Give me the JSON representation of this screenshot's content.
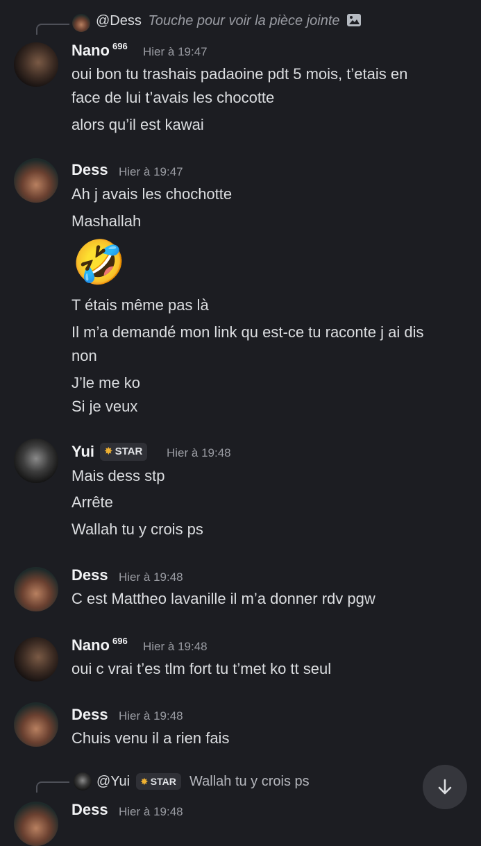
{
  "reply_top": {
    "author": "@Dess",
    "text": "Touche pour voir la pièce jointe",
    "attachment_icon": "image-icon"
  },
  "messages": [
    {
      "author": "Nano",
      "superscript": "696",
      "time": "Hier à 19:47",
      "lines": [
        "oui bon tu trashais padaoine pdt 5 mois, t’etais en",
        "face de lui t’avais les chocotte",
        "alors qu’il est kawai"
      ]
    },
    {
      "author": "Dess",
      "time": "Hier à 19:47",
      "lines": [
        "Ah j avais les chochotte",
        "Mashallah"
      ],
      "emoji": "🤣",
      "lines_after": [
        "T étais même pas là",
        "Il m’a demandé mon link qu est-ce tu raconte j ai dis",
        "non",
        "J’le me ko",
        "Si je veux"
      ]
    },
    {
      "author": "Yui",
      "badge": "STAR",
      "time": "Hier à 19:48",
      "lines": [
        "Mais dess stp",
        "Arrête",
        "Wallah tu y crois ps"
      ]
    },
    {
      "author": "Dess",
      "time": "Hier à 19:48",
      "lines": [
        "C est Mattheo lavanille il m’a donner rdv pgw"
      ]
    },
    {
      "author": "Nano",
      "superscript": "696",
      "time": "Hier à 19:48",
      "lines": [
        "oui c vrai t’es tlm fort tu t’met ko tt seul"
      ]
    },
    {
      "author": "Dess",
      "time": "Hier à 19:48",
      "lines": [
        "Chuis venu il a rien fais"
      ]
    },
    {
      "author": "Dess",
      "time": "Hier à 19:48",
      "lines": []
    }
  ],
  "reply_bottom": {
    "author": "@Yui",
    "badge": "STAR",
    "text": "Wallah tu y crois ps"
  },
  "colors": {
    "background": "#1c1d22",
    "text": "#dcdee1",
    "timestamp": "#9a9ca3",
    "badge_bg": "#2f3036",
    "badge_icon": "#f0b232"
  },
  "scroll_button": {
    "icon": "arrow-down-icon"
  }
}
